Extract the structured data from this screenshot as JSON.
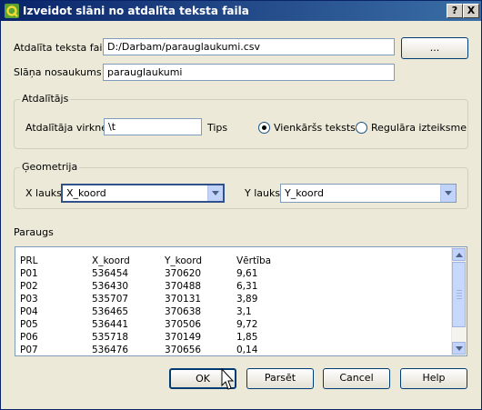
{
  "window": {
    "title": "Izveidot slāni no atdalīta teksta faila",
    "help_button": "?",
    "close_button": "X"
  },
  "file": {
    "label": "Atdalīta teksta fails",
    "value": "D:/Darbam/parauglaukumi.csv",
    "browse_button": "..."
  },
  "layer": {
    "label": "Slāņa nosaukums",
    "value": "parauglaukumi"
  },
  "delimiter": {
    "group_title": "Atdalītājs",
    "string_label": "Atdalītāja virkne",
    "string_value": "\\t",
    "type_label": "Tips",
    "option_plain": "Vienkāršs teksts",
    "option_regex": "Regulāra izteiksme",
    "selected": "plain"
  },
  "geometry": {
    "group_title": "Ģeometrija",
    "x_label": "X lauks",
    "x_value": "X_koord",
    "y_label": "Y lauks",
    "y_value": "Y_koord"
  },
  "sample": {
    "label": "Paraugs",
    "header": [
      "PRL",
      "X_koord",
      "Y_koord",
      "Vērtība"
    ],
    "rows": [
      [
        "P01",
        "536454",
        "370620",
        "9,61"
      ],
      [
        "P02",
        "536430",
        "370488",
        "6,31"
      ],
      [
        "P03",
        "535707",
        "370131",
        "3,89"
      ],
      [
        "P04",
        "536465",
        "370638",
        "3,1"
      ],
      [
        "P05",
        "536441",
        "370506",
        "9,72"
      ],
      [
        "P06",
        "535718",
        "370149",
        "1,85"
      ],
      [
        "P07",
        "536476",
        "370656",
        "0,14"
      ]
    ]
  },
  "buttons": {
    "ok": "OK",
    "parse": "Parsēt",
    "cancel": "Cancel",
    "help": "Help"
  },
  "colors": {
    "titlebar_start": "#0a246a",
    "titlebar_end": "#3a6ea5",
    "dialog_bg": "#ece9d8"
  }
}
